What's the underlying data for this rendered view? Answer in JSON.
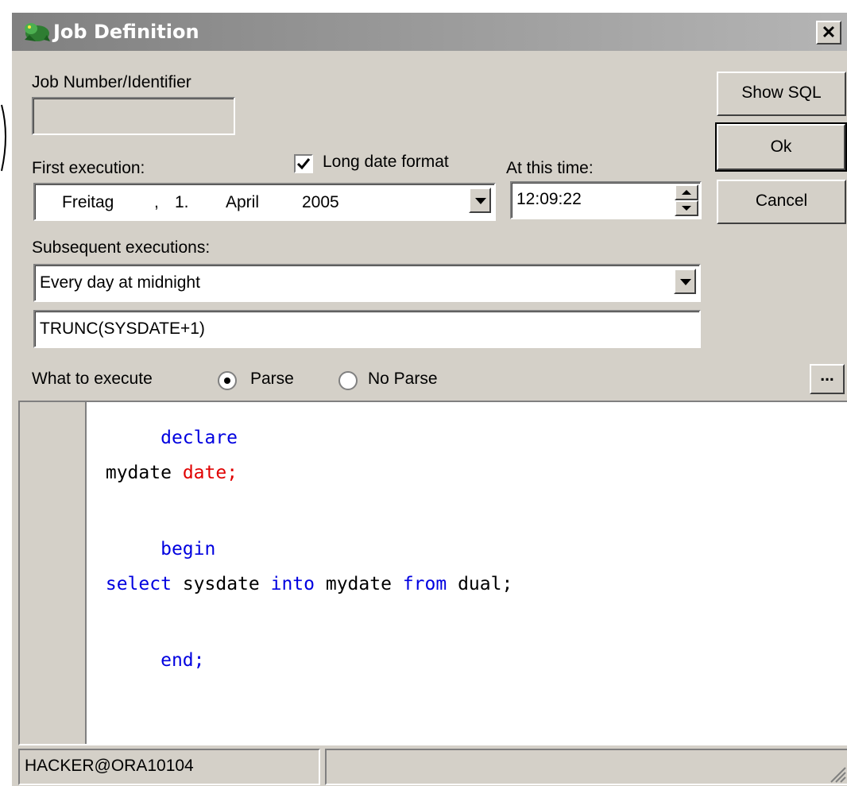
{
  "title": "Job Definition",
  "job_number": {
    "label": "Job Number/Identifier",
    "value": ""
  },
  "first_execution": {
    "label": "First execution:",
    "long_date_format_label": "Long date format",
    "long_date_checked": true,
    "weekday": "Freitag",
    "sep": ",",
    "day": "1.",
    "month": "April",
    "year": "2005"
  },
  "time": {
    "label": "At this time:",
    "value": "12:09:22"
  },
  "subsequent": {
    "label": "Subsequent executions:",
    "selected": "Every day at midnight",
    "expression": "TRUNC(SYSDATE+1)"
  },
  "what_to_execute": {
    "label": "What to execute",
    "parse_label": "Parse",
    "no_parse_label": "No Parse",
    "selected": "Parse",
    "ellipsis_label": "..."
  },
  "buttons": {
    "show_sql": "Show SQL",
    "ok": "Ok",
    "cancel": "Cancel"
  },
  "code": {
    "declare": "declare",
    "var": "mydate",
    "type": "date;",
    "begin": "begin",
    "select": "select",
    "sysdate": "sysdate",
    "into": "into",
    "mydate": "mydate",
    "from": "from",
    "dual": "dual;",
    "end": "end;"
  },
  "status": {
    "connection": "HACKER@ORA10104",
    "info": ""
  },
  "colors": {
    "keyword": "#0000e0",
    "type": "#e00000",
    "title_bar": "#808080",
    "dialog": "#d4d0c8"
  },
  "icons": [
    "toad-icon",
    "close-icon",
    "chevron-down-icon",
    "spinner-icon",
    "resize-grip-icon"
  ]
}
